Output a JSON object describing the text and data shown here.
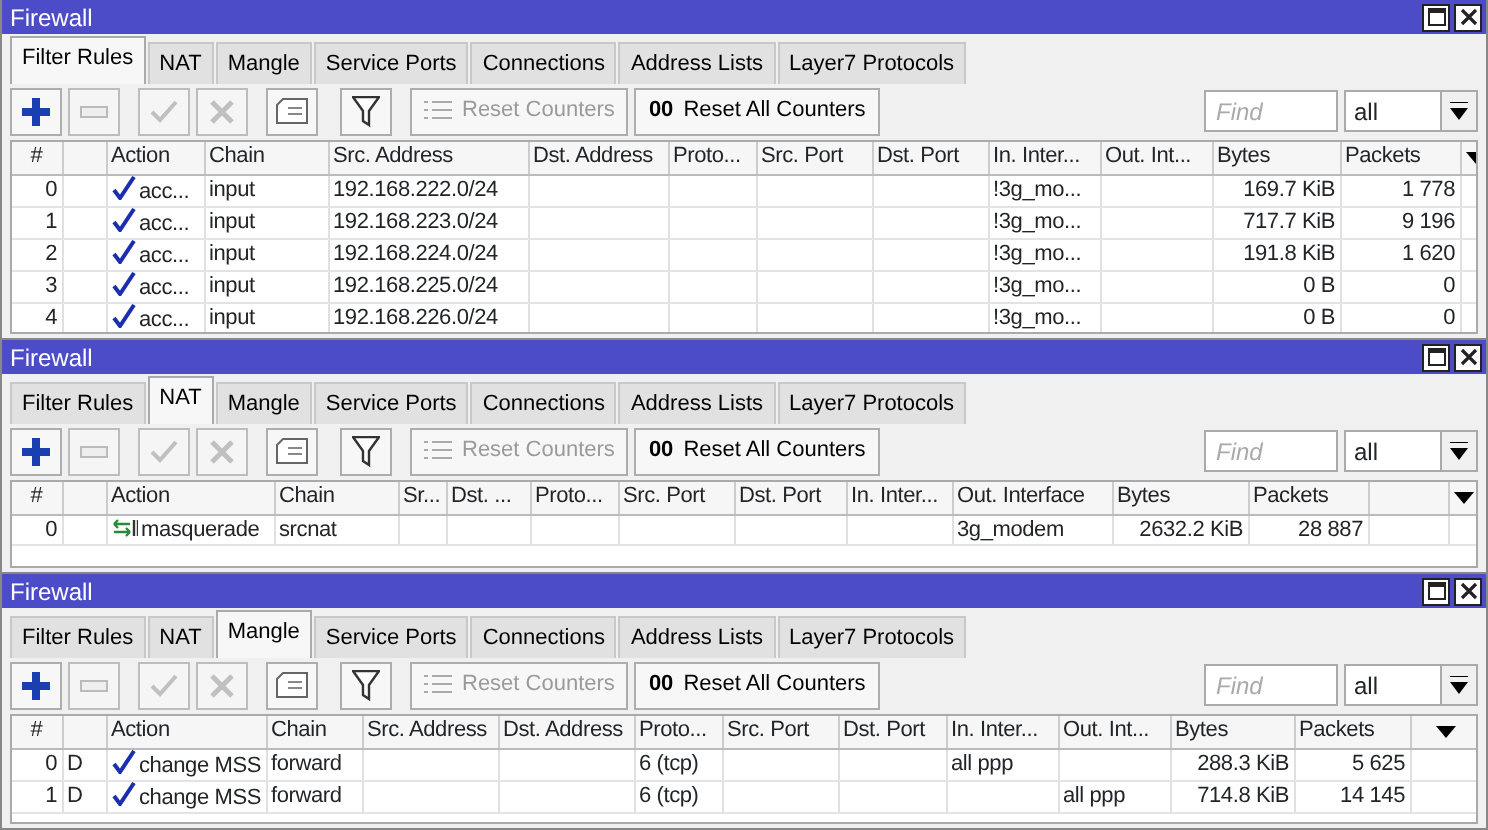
{
  "panels": [
    {
      "title": "Firewall",
      "tabs": [
        {
          "label": "Filter Rules",
          "selected": true
        },
        {
          "label": "NAT",
          "selected": false
        },
        {
          "label": "Mangle",
          "selected": false
        },
        {
          "label": "Service Ports",
          "selected": false
        },
        {
          "label": "Connections",
          "selected": false
        },
        {
          "label": "Address Lists",
          "selected": false
        },
        {
          "label": "Layer7 Protocols",
          "selected": false
        }
      ],
      "toolbar": {
        "tools": [
          {
            "kind": "add",
            "disabled": false
          },
          {
            "kind": "remove",
            "disabled": true
          },
          {
            "kind": "enable",
            "disabled": true
          },
          {
            "kind": "disable",
            "disabled": true
          },
          {
            "kind": "comment",
            "disabled": false
          },
          {
            "kind": "filter",
            "disabled": false
          }
        ],
        "reset_counters": {
          "label": "Reset Counters",
          "disabled": true
        },
        "reset_all_counters": {
          "mark": "00",
          "label": "Reset All Counters",
          "disabled": false
        },
        "find": {
          "placeholder": "Find"
        },
        "select": {
          "value": "all"
        }
      },
      "columns": [
        "#",
        "Action",
        "Chain",
        "Src. Address",
        "Dst. Address",
        "Proto...",
        "Src. Port",
        "Dst. Port",
        "In. Inter...",
        "Out. Int...",
        "Bytes",
        "Packets"
      ],
      "rows": [
        {
          "kind": "accept",
          "cells": [
            "0",
            "acc...",
            "input",
            "192.168.222.0/24",
            null,
            null,
            null,
            null,
            "!3g_mo...",
            null,
            "169.7 KiB",
            "1 778"
          ]
        },
        {
          "kind": "accept",
          "cells": [
            "1",
            "acc...",
            "input",
            "192.168.223.0/24",
            null,
            null,
            null,
            null,
            "!3g_mo...",
            null,
            "717.7 KiB",
            "9 196"
          ]
        },
        {
          "kind": "accept",
          "cells": [
            "2",
            "acc...",
            "input",
            "192.168.224.0/24",
            null,
            null,
            null,
            null,
            "!3g_mo...",
            null,
            "191.8 KiB",
            "1 620"
          ]
        },
        {
          "kind": "accept",
          "cells": [
            "3",
            "acc...",
            "input",
            "192.168.225.0/24",
            null,
            null,
            null,
            null,
            "!3g_mo...",
            null,
            "0 B",
            "0"
          ]
        },
        {
          "kind": "accept",
          "cells": [
            "4",
            "acc...",
            "input",
            "192.168.226.0/24",
            null,
            null,
            null,
            null,
            "!3g_mo...",
            null,
            "0 B",
            "0"
          ]
        }
      ]
    },
    {
      "title": "Firewall",
      "tabs": [
        {
          "label": "Filter Rules",
          "selected": false
        },
        {
          "label": "NAT",
          "selected": true
        },
        {
          "label": "Mangle",
          "selected": false
        },
        {
          "label": "Service Ports",
          "selected": false
        },
        {
          "label": "Connections",
          "selected": false
        },
        {
          "label": "Address Lists",
          "selected": false
        },
        {
          "label": "Layer7 Protocols",
          "selected": false
        }
      ],
      "toolbar": {
        "tools": [
          {
            "kind": "add",
            "disabled": false
          },
          {
            "kind": "remove",
            "disabled": true
          },
          {
            "kind": "enable",
            "disabled": true
          },
          {
            "kind": "disable",
            "disabled": true
          },
          {
            "kind": "comment",
            "disabled": false
          },
          {
            "kind": "filter",
            "disabled": false
          }
        ],
        "reset_counters": {
          "label": "Reset Counters",
          "disabled": true
        },
        "reset_all_counters": {
          "mark": "00",
          "label": "Reset All Counters",
          "disabled": false
        },
        "find": {
          "placeholder": "Find"
        },
        "select": {
          "value": "all"
        }
      },
      "columns": [
        "#",
        "Action",
        "Chain",
        "Sr...",
        "Dst. ...",
        "Proto...",
        "Src. Port",
        "Dst. Port",
        "In. Inter...",
        "Out. Interface",
        "Bytes",
        "Packets"
      ],
      "rows": [
        {
          "kind": "masquerade",
          "cells": [
            "0",
            "masquerade",
            "srcnat",
            null,
            null,
            null,
            null,
            null,
            null,
            "3g_modem",
            "2632.2 KiB",
            "28 887"
          ]
        }
      ]
    },
    {
      "title": "Firewall",
      "tabs": [
        {
          "label": "Filter Rules",
          "selected": false
        },
        {
          "label": "NAT",
          "selected": false
        },
        {
          "label": "Mangle",
          "selected": true
        },
        {
          "label": "Service Ports",
          "selected": false
        },
        {
          "label": "Connections",
          "selected": false
        },
        {
          "label": "Address Lists",
          "selected": false
        },
        {
          "label": "Layer7 Protocols",
          "selected": false
        }
      ],
      "toolbar": {
        "tools": [
          {
            "kind": "add",
            "disabled": false
          },
          {
            "kind": "remove",
            "disabled": true
          },
          {
            "kind": "enable",
            "disabled": true
          },
          {
            "kind": "disable",
            "disabled": true
          },
          {
            "kind": "comment",
            "disabled": false
          },
          {
            "kind": "filter",
            "disabled": false
          }
        ],
        "reset_counters": {
          "label": "Reset Counters",
          "disabled": true
        },
        "reset_all_counters": {
          "mark": "00",
          "label": "Reset All Counters",
          "disabled": false
        },
        "find": {
          "placeholder": "Find"
        },
        "select": {
          "value": "all"
        }
      },
      "columns": [
        "#",
        "Action",
        "Chain",
        "Src. Address",
        "Dst. Address",
        "Proto...",
        "Src. Port",
        "Dst. Port",
        "In. Inter...",
        "Out. Int...",
        "Bytes",
        "Packets"
      ],
      "rows": [
        {
          "flag": "D",
          "kind": "accept",
          "cells": [
            "0",
            "change MSS",
            "forward",
            null,
            null,
            "6 (tcp)",
            null,
            null,
            "all ppp",
            null,
            "288.3 KiB",
            "5 625"
          ]
        },
        {
          "flag": "D",
          "kind": "accept",
          "cells": [
            "1",
            "change MSS",
            "forward",
            null,
            null,
            "6 (tcp)",
            null,
            null,
            null,
            "all ppp",
            "714.8 KiB",
            "14 145"
          ]
        }
      ]
    }
  ]
}
